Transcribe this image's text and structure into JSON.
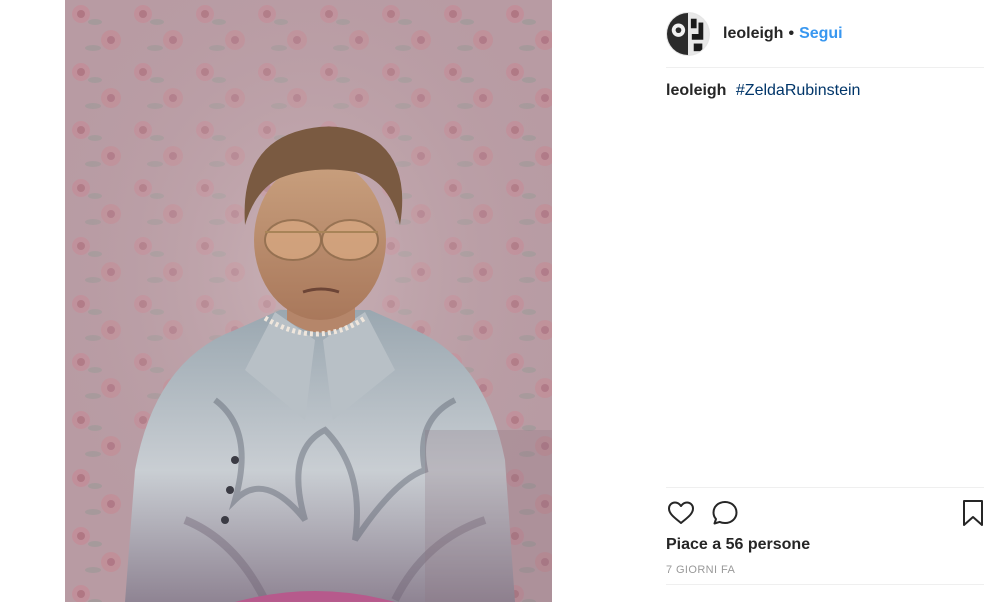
{
  "post": {
    "image_alt": "Ritratto dipinto di una donna con occhiali e camicetta floreale su carta da parati a rose"
  },
  "header": {
    "username": "leoleigh",
    "separator": "•",
    "follow_label": "Segui"
  },
  "caption": {
    "username": "leoleigh",
    "hashtag": "#ZeldaRubinstein"
  },
  "actions": {
    "like_icon": "heart-icon",
    "comment_icon": "comment-bubble-icon",
    "save_icon": "bookmark-icon"
  },
  "likes": {
    "text": "Piace a 56 persone"
  },
  "timestamp": {
    "text": "7 GIORNI FA"
  },
  "colors": {
    "link_blue": "#3897f0",
    "hashtag_blue": "#003569",
    "text_dark": "#262626",
    "muted_gray": "#999999",
    "divider": "#efefef"
  }
}
